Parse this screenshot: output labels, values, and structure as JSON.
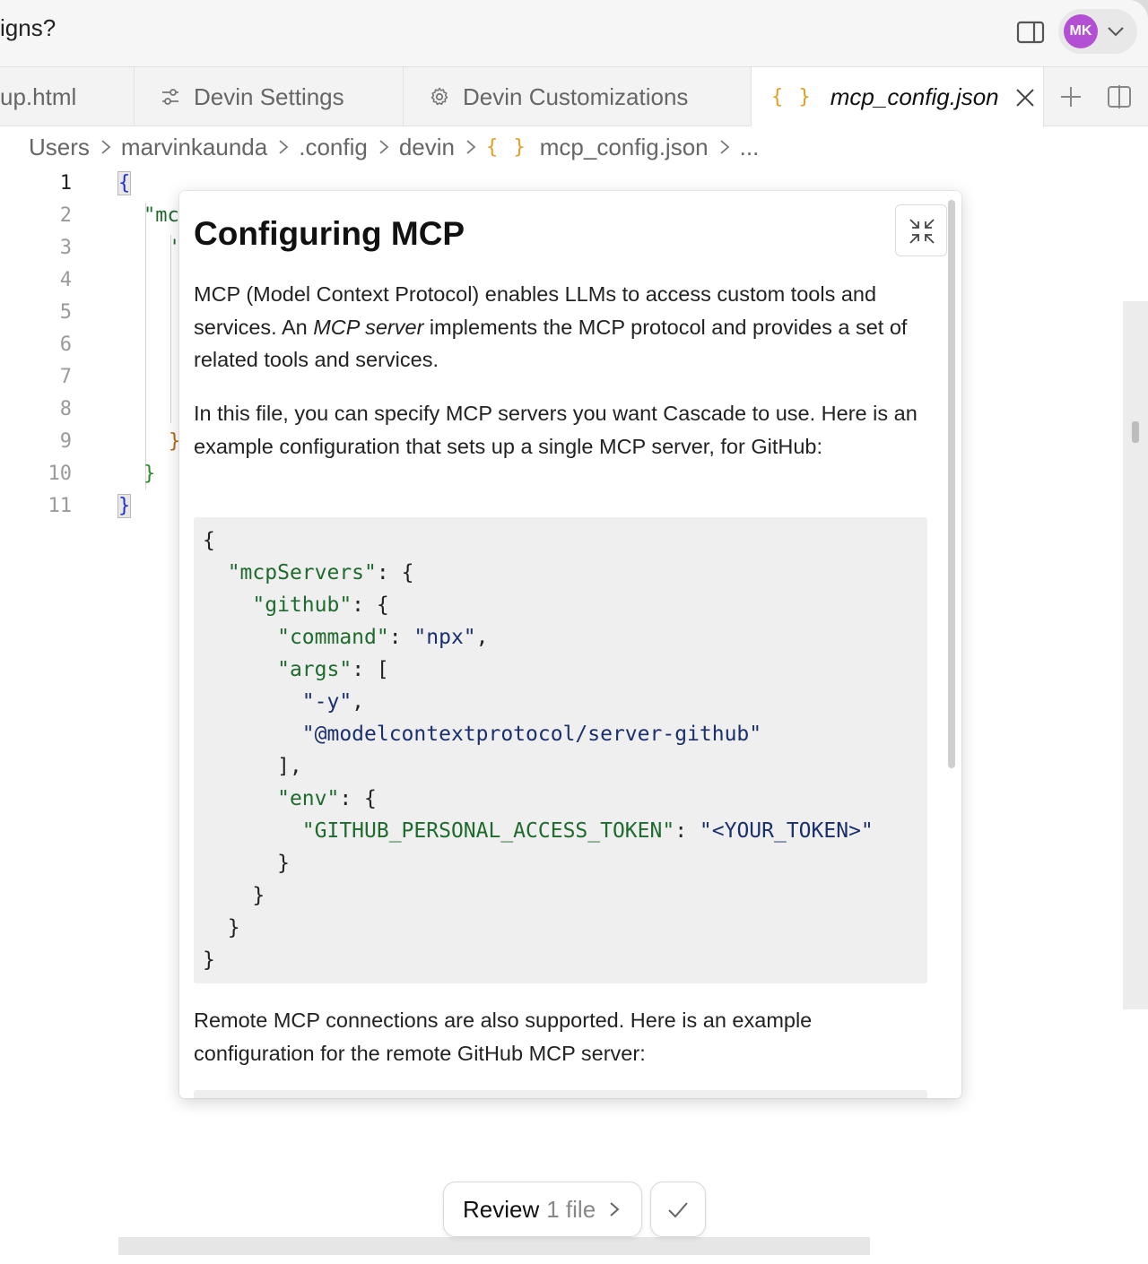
{
  "titlebar": {
    "title": "igns?",
    "avatar_initials": "MK",
    "avatar_color": "#b24fd3"
  },
  "tabs": [
    {
      "label": "up.html",
      "icon": "none"
    },
    {
      "label": "Devin Settings",
      "icon": "sliders-icon"
    },
    {
      "label": "Devin Customizations",
      "icon": "gear-icon"
    },
    {
      "label": "mcp_config.json",
      "icon": "json-braces-icon",
      "brace": "{ }",
      "active": true
    }
  ],
  "breadcrumb": {
    "items": [
      "Users",
      "marvinkaunda",
      ".config",
      "devin"
    ],
    "file_icon": "{ }",
    "file": "mcp_config.json",
    "ellipsis": "..."
  },
  "editor": {
    "line_numbers": [
      "1",
      "2",
      "3",
      "4",
      "5",
      "6",
      "7",
      "8",
      "9",
      "10",
      "11"
    ],
    "current_line": 1,
    "lines": {
      "l1": "{",
      "l2": "\"mc",
      "l3": "'",
      "l9": "}",
      "l10": "}",
      "l11": "}"
    }
  },
  "popup": {
    "title": "Configuring MCP",
    "p1_a": "MCP (Model Context Protocol) enables LLMs to access custom tools and services. An ",
    "p1_em": "MCP server",
    "p1_b": " implements the MCP protocol and provides a set of related tools and services.",
    "p2": "In this file, you can specify MCP servers you want Cascade to use. Here is an example configuration that sets up a single MCP server, for GitHub:",
    "code": {
      "mcpServers_key": "\"mcpServers\"",
      "github_key": "\"github\"",
      "command_key": "\"command\"",
      "command_val": "\"npx\"",
      "args_key": "\"args\"",
      "arg1": "\"-y\"",
      "arg2": "\"@modelcontextprotocol/server-github\"",
      "env_key": "\"env\"",
      "token_key": "\"GITHUB_PERSONAL_ACCESS_TOKEN\"",
      "token_val": "\"<YOUR_TOKEN>\""
    },
    "p3": "Remote MCP connections are also supported. Here is an example configuration for the remote GitHub MCP server:"
  },
  "review": {
    "label": "Review",
    "count": "1 file"
  },
  "colors": {
    "json_key": "#1f6b2e",
    "json_string": "#1a2f6e",
    "brace_icon": "#e0a028"
  }
}
